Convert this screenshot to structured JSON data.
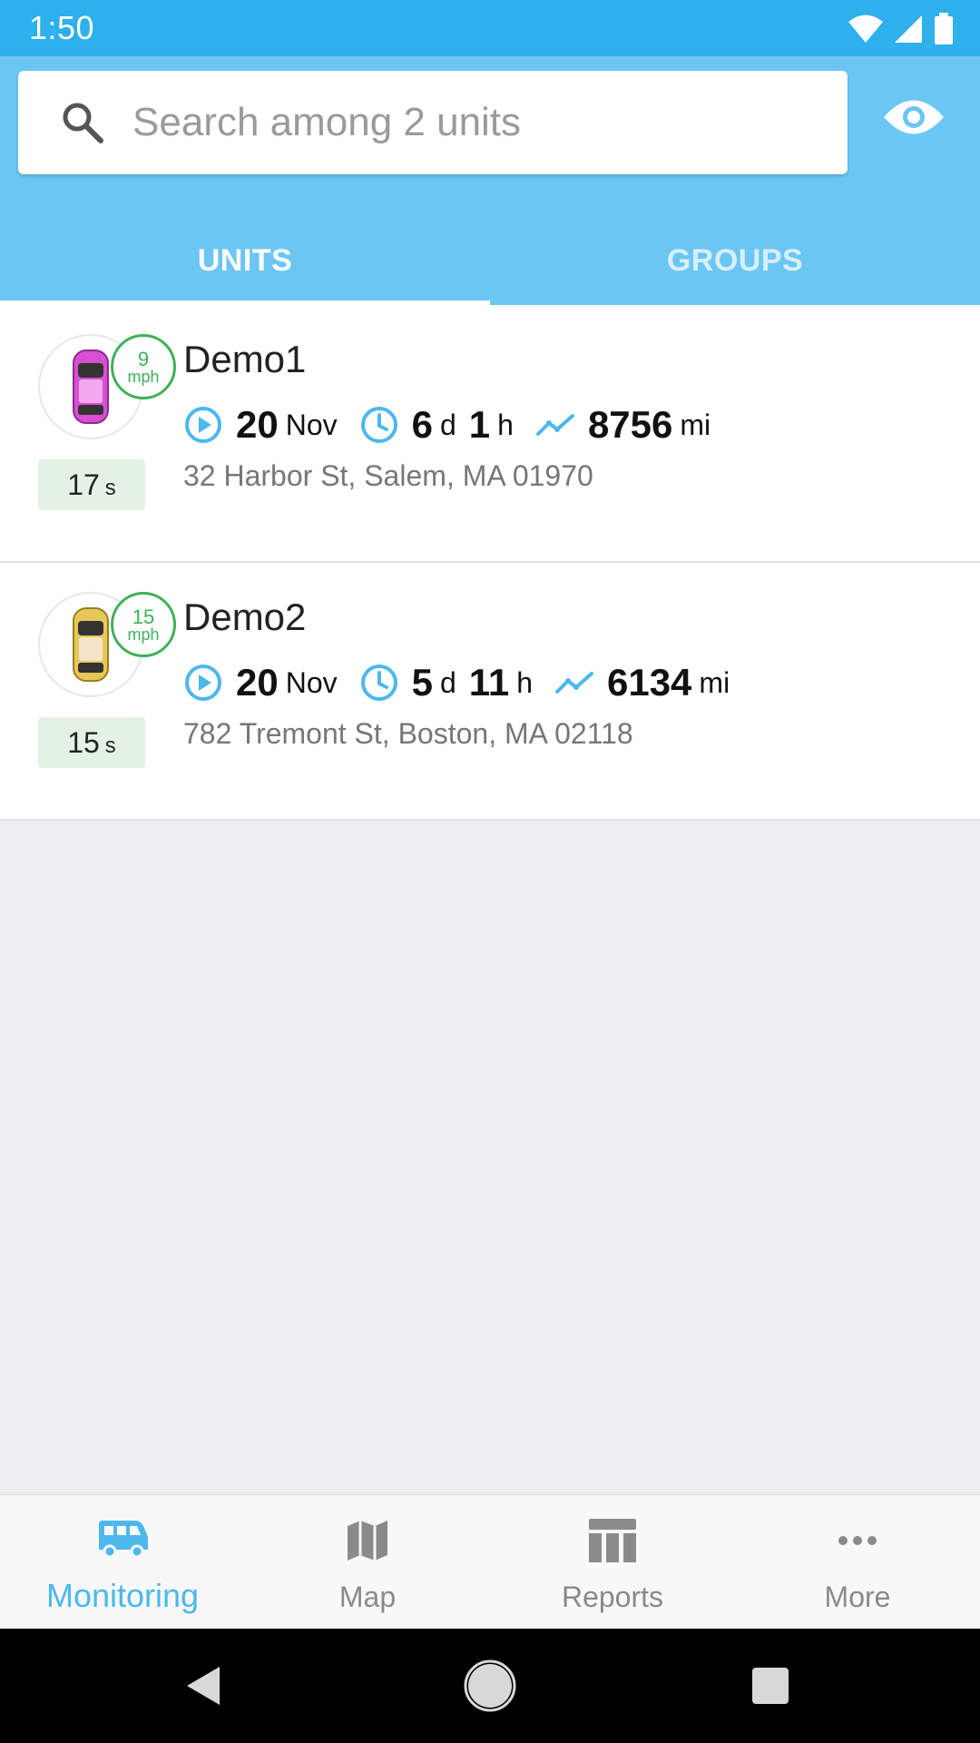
{
  "status_bar": {
    "time": "1:50"
  },
  "search": {
    "placeholder": "Search among 2 units",
    "value": ""
  },
  "tabs": [
    {
      "label": "UNITS",
      "active": true
    },
    {
      "label": "GROUPS",
      "active": false
    }
  ],
  "units": [
    {
      "name": "Demo1",
      "speed": "9",
      "speed_unit": "mph",
      "age_value": "17",
      "age_unit": "s",
      "date_day": "20",
      "date_month": "Nov",
      "duration_days": "6",
      "duration_days_unit": "d",
      "duration_hours": "1",
      "duration_hours_unit": "h",
      "mileage": "8756",
      "mileage_unit": "mi",
      "address": "32 Harbor St, Salem, MA 01970",
      "car_color": "#d94fd3"
    },
    {
      "name": "Demo2",
      "speed": "15",
      "speed_unit": "mph",
      "age_value": "15",
      "age_unit": "s",
      "date_day": "20",
      "date_month": "Nov",
      "duration_days": "5",
      "duration_days_unit": "d",
      "duration_hours": "11",
      "duration_hours_unit": "h",
      "mileage": "6134",
      "mileage_unit": "mi",
      "address": "782 Tremont St, Boston, MA 02118",
      "car_color": "#e6c85a"
    }
  ],
  "bottom_nav": [
    {
      "label": "Monitoring",
      "icon": "bus-icon",
      "active": true
    },
    {
      "label": "Map",
      "icon": "map-icon",
      "active": false
    },
    {
      "label": "Reports",
      "icon": "reports-icon",
      "active": false
    },
    {
      "label": "More",
      "icon": "more-icon",
      "active": false
    }
  ],
  "colors": {
    "status_bar": "#2db0ec",
    "header": "#6cc6f3",
    "accent": "#4cb8ed",
    "speed_green": "#3fb05b"
  }
}
